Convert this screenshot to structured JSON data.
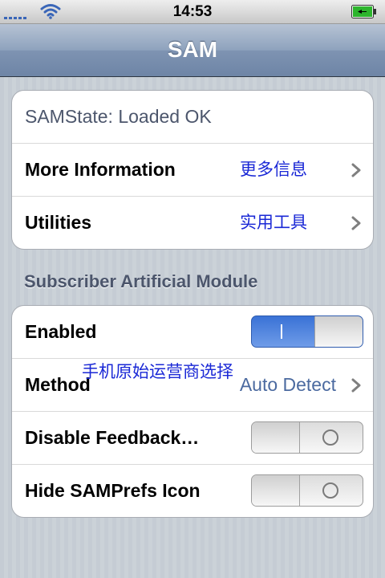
{
  "status_bar": {
    "time": "14:53"
  },
  "nav": {
    "title": "SAM"
  },
  "group1": {
    "state": "SAMState: Loaded OK",
    "more_info": {
      "label": "More Information",
      "value": "更多信息"
    },
    "utilities": {
      "label": "Utilities",
      "value": "实用工具"
    }
  },
  "section": {
    "header": "Subscriber Artificial Module"
  },
  "group2": {
    "enabled": {
      "label": "Enabled",
      "on": true
    },
    "method": {
      "label": "Method",
      "value": "Auto Detect",
      "overlay": "手机原始运营商选择"
    },
    "disable_feedback": {
      "label": "Disable Feedback…",
      "on": false
    },
    "hide_icon": {
      "label": "Hide SAMPrefs Icon",
      "on": false
    }
  },
  "colors": {
    "accent_blue": "#3a72d6",
    "detail_text": "#4b6aa0",
    "cn_annotation": "#1a28d6",
    "battery_green": "#2db52d"
  },
  "icons": [
    "signal-bars-icon",
    "wifi-icon",
    "battery-charging-icon",
    "chevron-right-icon"
  ]
}
